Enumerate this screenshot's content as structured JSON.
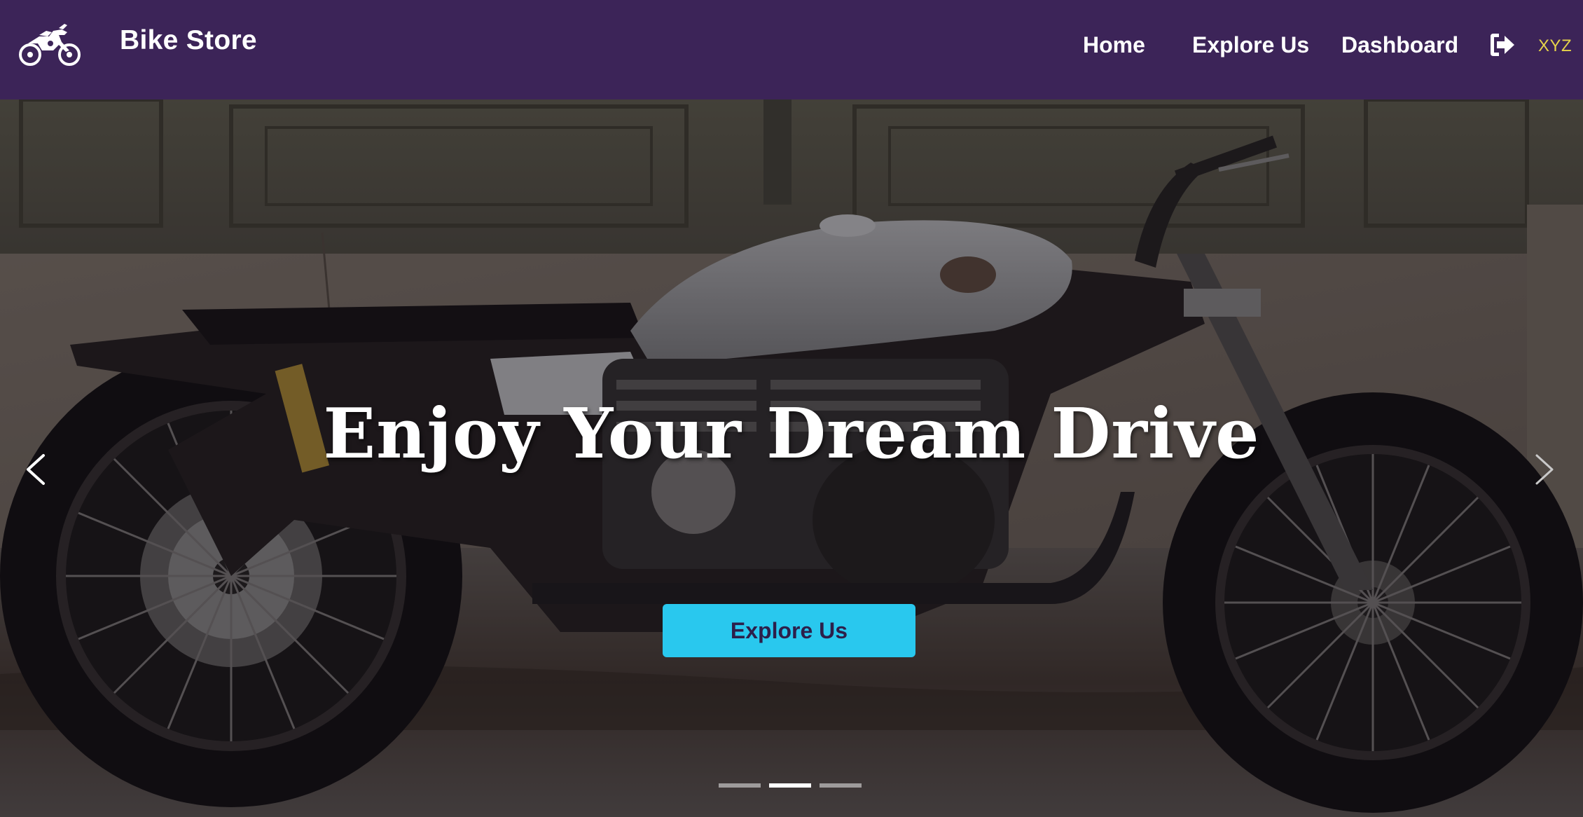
{
  "navbar": {
    "brand": {
      "logo_icon": "motorcycle-icon",
      "name": "Bike Store"
    },
    "links": [
      {
        "label": "Home"
      },
      {
        "label": "Explore Us"
      },
      {
        "label": "Dashboard"
      }
    ],
    "logout_icon": "sign-out-icon",
    "user": "XYZ",
    "colors": {
      "background": "#3c2458",
      "link": "#ffffff",
      "user": "#e6d34a"
    }
  },
  "hero": {
    "title": "Enjoy Your Dream Drive",
    "cta_label": "Explore Us",
    "background_image": "motorcycle-photo",
    "prev_icon": "chevron-left-icon",
    "next_icon": "chevron-right-icon",
    "slides_count": 3,
    "active_slide": 2,
    "colors": {
      "cta_background": "#29c8ee",
      "cta_text": "#2d1f4a"
    }
  }
}
